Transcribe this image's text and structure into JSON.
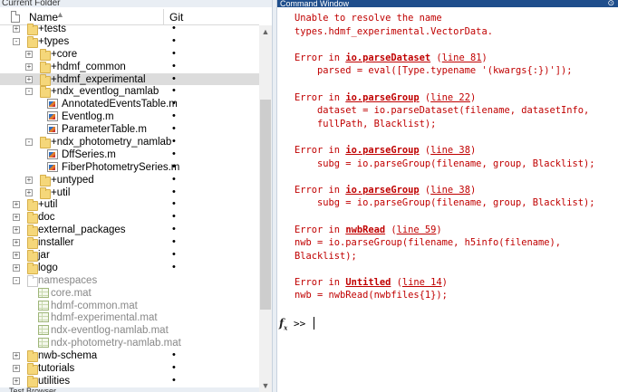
{
  "folder_panel": {
    "title": "Current Folder",
    "header": {
      "name_label": "Name",
      "git_label": "Git",
      "sort_glyph": "▲"
    },
    "rows": [
      {
        "label": "+tests",
        "level": 1,
        "expander": "+",
        "icon": "folder",
        "git": "•"
      },
      {
        "label": "+types",
        "level": 1,
        "expander": "-",
        "icon": "folder",
        "git": "•"
      },
      {
        "label": "+core",
        "level": 2,
        "expander": "+",
        "icon": "folder",
        "git": "•"
      },
      {
        "label": "+hdmf_common",
        "level": 2,
        "expander": "+",
        "icon": "folder",
        "git": "•"
      },
      {
        "label": "+hdmf_experimental",
        "level": 2,
        "expander": "+",
        "icon": "folder",
        "git": "•",
        "selected": true
      },
      {
        "label": "+ndx_eventlog_namlab",
        "level": 2,
        "expander": "-",
        "icon": "folder",
        "git": "•"
      },
      {
        "label": "AnnotatedEventsTable.m",
        "level": 3,
        "icon": "m",
        "git": "•"
      },
      {
        "label": "Eventlog.m",
        "level": 3,
        "icon": "m",
        "git": "•"
      },
      {
        "label": "ParameterTable.m",
        "level": 3,
        "icon": "m",
        "git": "•"
      },
      {
        "label": "+ndx_photometry_namlab",
        "level": 2,
        "expander": "-",
        "icon": "folder",
        "git": "•"
      },
      {
        "label": "DffSeries.m",
        "level": 3,
        "icon": "m",
        "git": "•"
      },
      {
        "label": "FiberPhotometrySeries.m",
        "level": 3,
        "icon": "m",
        "git": "•"
      },
      {
        "label": "+untyped",
        "level": 2,
        "expander": "+",
        "icon": "folder",
        "git": "•"
      },
      {
        "label": "+util",
        "level": 2,
        "expander": "+",
        "icon": "folder",
        "git": "•"
      },
      {
        "label": "+util",
        "level": 1,
        "expander": "+",
        "icon": "folder",
        "git": "•"
      },
      {
        "label": "doc",
        "level": 1,
        "expander": "+",
        "icon": "folder",
        "git": "•"
      },
      {
        "label": "external_packages",
        "level": 1,
        "expander": "+",
        "icon": "folder",
        "git": "•"
      },
      {
        "label": "installer",
        "level": 1,
        "expander": "+",
        "icon": "folder",
        "git": "•"
      },
      {
        "label": "jar",
        "level": 1,
        "expander": "+",
        "icon": "folder",
        "git": "•"
      },
      {
        "label": "logo",
        "level": 1,
        "expander": "+",
        "icon": "folder",
        "git": "•"
      },
      {
        "label": "namespaces",
        "level": 1,
        "expander": "-",
        "icon": "ns-folder",
        "git": "",
        "dim": true
      },
      {
        "label": "core.mat",
        "level": 2,
        "icon": "mat",
        "git": "",
        "dim": true
      },
      {
        "label": "hdmf-common.mat",
        "level": 2,
        "icon": "mat",
        "git": "",
        "dim": true
      },
      {
        "label": "hdmf-experimental.mat",
        "level": 2,
        "icon": "mat",
        "git": "",
        "dim": true
      },
      {
        "label": "ndx-eventlog-namlab.mat",
        "level": 2,
        "icon": "mat",
        "git": "",
        "dim": true
      },
      {
        "label": "ndx-photometry-namlab.mat",
        "level": 2,
        "icon": "mat",
        "git": "",
        "dim": true
      },
      {
        "label": "nwb-schema",
        "level": 1,
        "expander": "+",
        "icon": "folder",
        "git": "•"
      },
      {
        "label": "tutorials",
        "level": 1,
        "expander": "+",
        "icon": "folder",
        "git": "•"
      },
      {
        "label": "utilities",
        "level": 1,
        "expander": "+",
        "icon": "folder",
        "git": "•"
      }
    ],
    "bottom_label": "Test Browser"
  },
  "command_window": {
    "title": "Command Window",
    "output_lines": [
      [
        {
          "t": "Unable to resolve the name"
        }
      ],
      [
        {
          "t": "types.hdmf_experimental.VectorData."
        }
      ],
      [
        {
          "t": ""
        }
      ],
      [
        {
          "t": "Error in "
        },
        {
          "t": "io.parseDataset",
          "kind": "fn"
        },
        {
          "t": " ("
        },
        {
          "t": "line 81",
          "kind": "ln"
        },
        {
          "t": ")"
        }
      ],
      [
        {
          "t": "    parsed = eval([Type.typename '(kwargs{:})']);"
        }
      ],
      [
        {
          "t": ""
        }
      ],
      [
        {
          "t": "Error in "
        },
        {
          "t": "io.parseGroup",
          "kind": "fn"
        },
        {
          "t": " ("
        },
        {
          "t": "line 22",
          "kind": "ln"
        },
        {
          "t": ")"
        }
      ],
      [
        {
          "t": "    dataset = io.parseDataset(filename, datasetInfo,"
        }
      ],
      [
        {
          "t": "    fullPath, Blacklist);"
        }
      ],
      [
        {
          "t": ""
        }
      ],
      [
        {
          "t": "Error in "
        },
        {
          "t": "io.parseGroup",
          "kind": "fn"
        },
        {
          "t": " ("
        },
        {
          "t": "line 38",
          "kind": "ln"
        },
        {
          "t": ")"
        }
      ],
      [
        {
          "t": "    subg = io.parseGroup(filename, group, Blacklist);"
        }
      ],
      [
        {
          "t": ""
        }
      ],
      [
        {
          "t": "Error in "
        },
        {
          "t": "io.parseGroup",
          "kind": "fn"
        },
        {
          "t": " ("
        },
        {
          "t": "line 38",
          "kind": "ln"
        },
        {
          "t": ")"
        }
      ],
      [
        {
          "t": "    subg = io.parseGroup(filename, group, Blacklist);"
        }
      ],
      [
        {
          "t": ""
        }
      ],
      [
        {
          "t": "Error in "
        },
        {
          "t": "nwbRead",
          "kind": "fn"
        },
        {
          "t": " ("
        },
        {
          "t": "line 59",
          "kind": "ln"
        },
        {
          "t": ")"
        }
      ],
      [
        {
          "t": "nwb = io.parseGroup(filename, h5info(filename),"
        }
      ],
      [
        {
          "t": "Blacklist);"
        }
      ],
      [
        {
          "t": ""
        }
      ],
      [
        {
          "t": "Error in "
        },
        {
          "t": "Untitled",
          "kind": "fn"
        },
        {
          "t": " ("
        },
        {
          "t": "line 14",
          "kind": "ln"
        },
        {
          "t": ")"
        }
      ],
      [
        {
          "t": "nwb = nwbRead(nwbfiles{1});"
        }
      ]
    ],
    "prompt": ">>",
    "error_color": "#c00000"
  }
}
